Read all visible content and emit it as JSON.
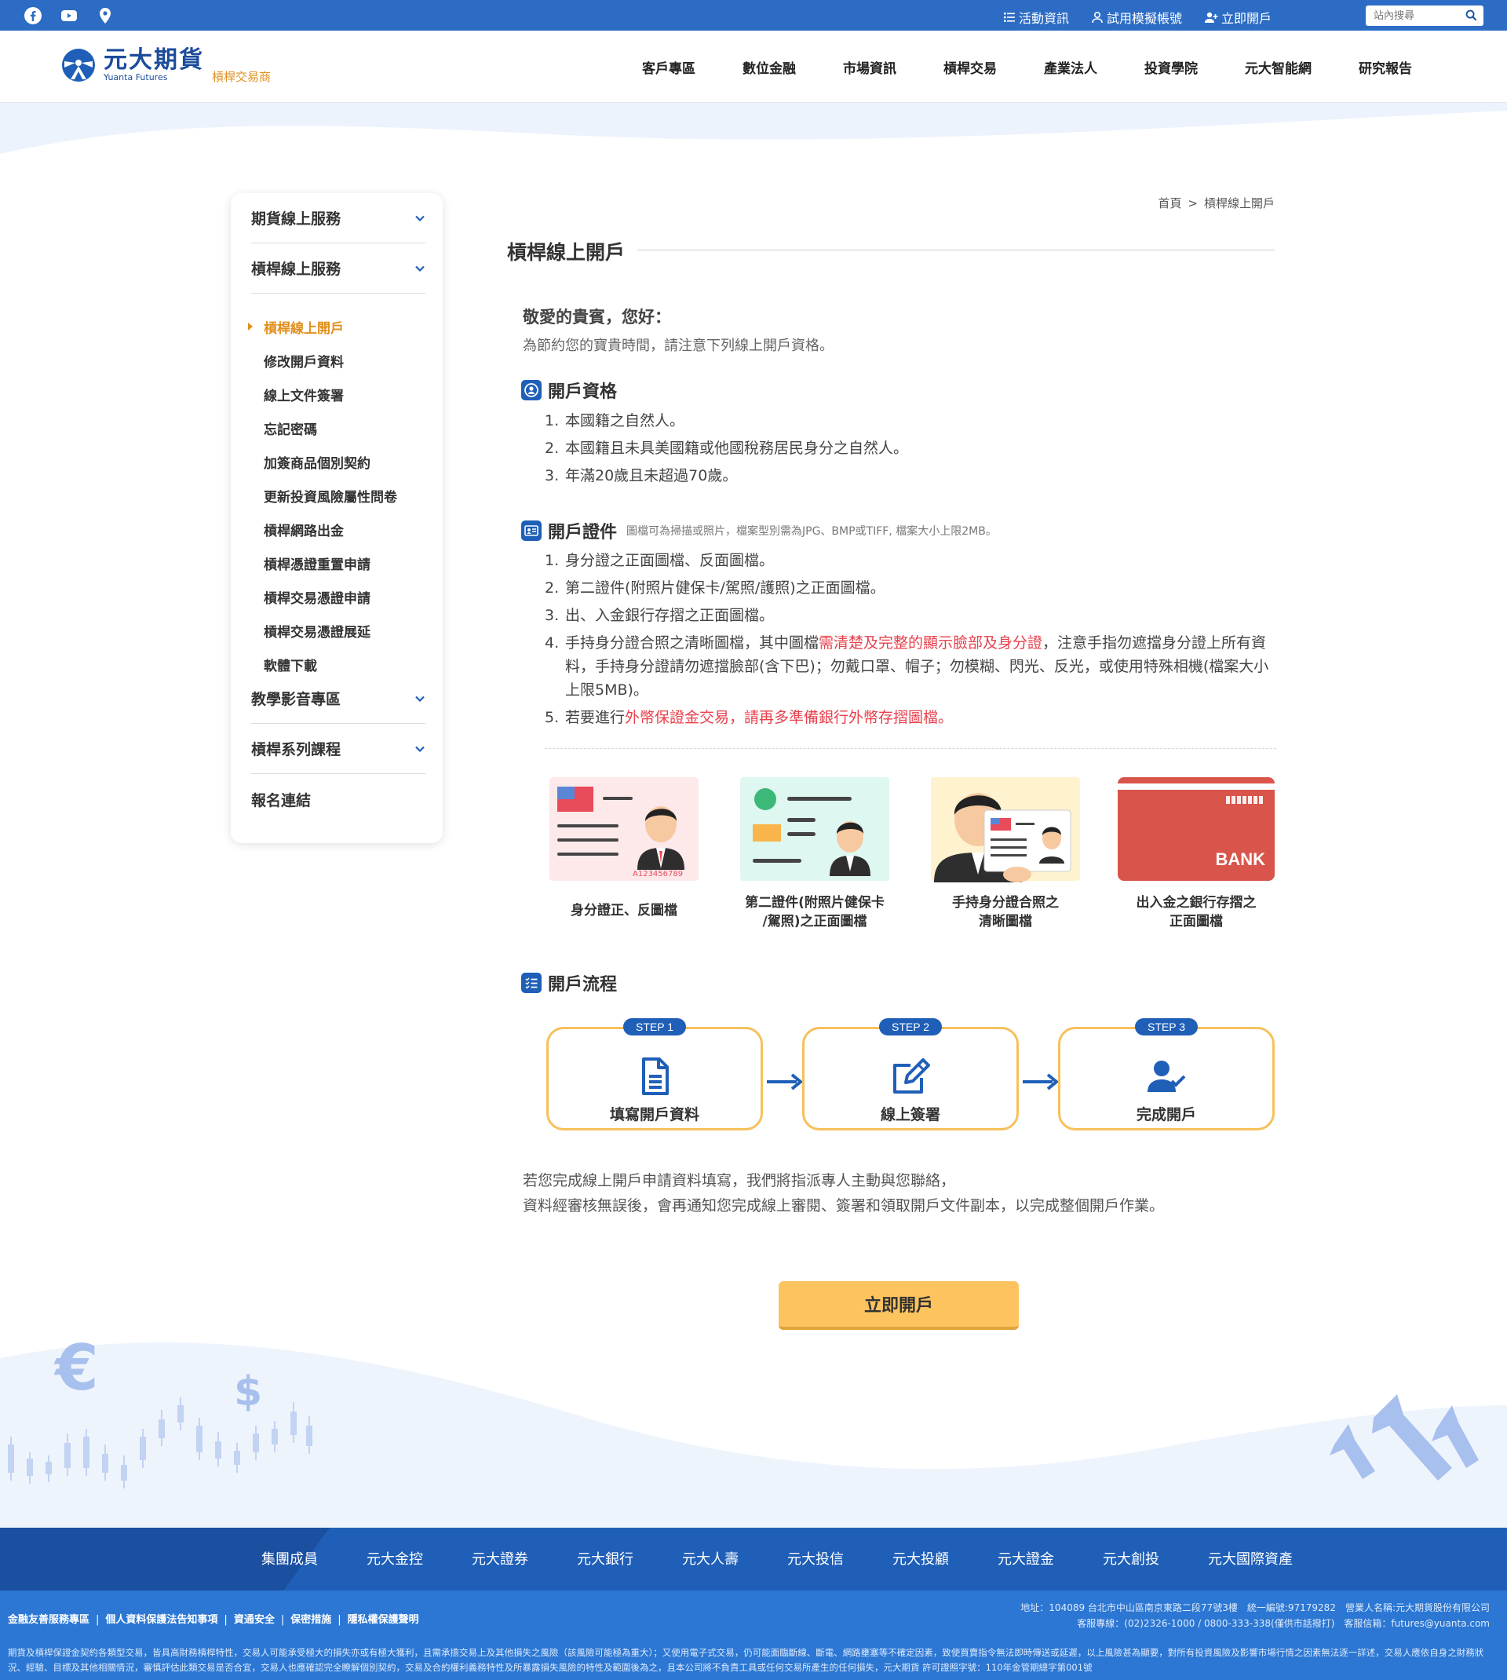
{
  "topbar": {
    "links": [
      "活動資訊",
      "試用模擬帳號",
      "立即開戶"
    ],
    "search_placeholder": "站內搜尋"
  },
  "brand": {
    "name_cn": "元大期貨",
    "name_en": "Yuanta Futures",
    "subtitle": "槓桿交易商"
  },
  "nav": [
    "客戶專區",
    "數位金融",
    "市場資訊",
    "槓桿交易",
    "產業法人",
    "投資學院",
    "元大智能網",
    "研究報告"
  ],
  "sidebar": {
    "groups": [
      "期貨線上服務",
      "槓桿線上服務"
    ],
    "items": [
      "槓桿線上開戶",
      "修改開戶資料",
      "線上文件簽署",
      "忘記密碼",
      "加簽商品個別契約",
      "更新投資風險屬性問卷",
      "槓桿網路出金",
      "槓桿憑證重置申請",
      "槓桿交易憑證申請",
      "槓桿交易憑證展延",
      "軟體下載"
    ],
    "groups_after": [
      "教學影音專區",
      "槓桿系列課程",
      "報名連結"
    ]
  },
  "breadcrumb": {
    "home": "首頁",
    "sep": ">",
    "current": "槓桿線上開戶"
  },
  "page_title": "槓桿線上開戶",
  "greeting": "敬愛的貴賓，您好：",
  "greeting_sub": "為節約您的寶貴時間，請注意下列線上開戶資格。",
  "qualification": {
    "title": "開戶資格",
    "items": [
      "本國籍之自然人。",
      "本國籍且未具美國籍或他國稅務居民身分之自然人。",
      "年滿20歲且未超過70歲。"
    ]
  },
  "documents": {
    "title": "開戶證件",
    "note": "圖檔可為掃描或照片，檔案型別需為JPG、BMP或TIFF, 檔案大小上限2MB。",
    "item1": "身分證之正面圖檔、反面圖檔。",
    "item2": "第二證件(附照片健保卡/駕照/護照)之正面圖檔。",
    "item3": "出、入金銀行存摺之正面圖檔。",
    "item4_pre": "手持身分證合照之清晰圖檔，其中圖檔",
    "item4_red": "需清楚及完整的顯示臉部及身分證",
    "item4_post": "，注意手指勿遮擋身分證上所有資料，手持身分證請勿遮擋臉部(含下巴)；勿戴口罩、帽子；勿模糊、閃光、反光，或使用特殊相機(檔案大小上限5MB)。",
    "item5_pre": "若要進行",
    "item5_red": "外幣保證金交易，請再多準備銀行外幣存摺圖檔。"
  },
  "cards": {
    "c1": "身分證正、反圖檔",
    "c2a": "第二證件(附照片健保卡",
    "c2b": "/駕照)之正面圖檔",
    "c3a": "手持身分證合照之",
    "c3b": "清晰圖檔",
    "c4a": "出入金之銀行存摺之",
    "c4b": "正面圖檔",
    "id_number": "A123456789",
    "bank_label": "BANK"
  },
  "process": {
    "title": "開戶流程",
    "steps": [
      {
        "badge": "STEP 1",
        "label": "填寫開戶資料"
      },
      {
        "badge": "STEP 2",
        "label": "線上簽署"
      },
      {
        "badge": "STEP 3",
        "label": "完成開戶"
      }
    ]
  },
  "finish_line1": "若您完成線上開戶申請資料填寫，我們將指派專人主動與您聯絡，",
  "finish_line2": "資料經審核無誤後，會再通知您完成線上審閱、簽署和領取開戶文件副本，以完成整個開戶作業。",
  "cta_label": "立即開戶",
  "footer": {
    "group_label": "集團成員",
    "members": [
      "元大金控",
      "元大證券",
      "元大銀行",
      "元大人壽",
      "元大投信",
      "元大投顧",
      "元大證金",
      "元大創投",
      "元大國際資產"
    ],
    "policy_links": [
      "金融友善服務專區",
      "個人資料保護法告知事項",
      "資通安全",
      "保密措施",
      "隱私權保護聲明"
    ],
    "address": "地址：104089 台北市中山區南京東路二段77號3樓　統一編號:97179282　營業人名稱:元大期貨股份有限公司",
    "contact": "客服專線：(02)2326-1000 / 0800-333-338(僅供市話撥打)　客服信箱：futures@yuanta.com",
    "disclaimer": "期貨及槓桿保證金契約各類型交易，皆具高財務槓桿特性，交易人可能承受極大的損失亦或有極大獲利，且需承擔交易上及其他損失之風險（該風險可能極為重大）；又使用電子式交易，仍可能面臨斷線、斷電、網路壅塞等不確定因素，致使買賣指令無法即時傳送或延遲，以上風險甚為顯要，對所有投資風險及影響市場行情之因素無法逐一詳述，交易人應依自身之財務狀況、經驗、目標及其他相關情況，審慎評估此類交易是否合宜，交易人也應確認完全瞭解個別契約，交易及合約權利義務特性及所暴露損失風險的特性及範圍後為之，且本公司將不負責工具或任何交易所產生的任何損失，元大期貨 許可證照字號：110年金管期總字第001號"
  },
  "colors": {
    "primary_blue": "#2c6cc4",
    "accent_orange": "#e08f1b",
    "warning_red": "#e8404c",
    "cta_yellow": "#fcc35e",
    "step_border": "#f6c15b"
  }
}
